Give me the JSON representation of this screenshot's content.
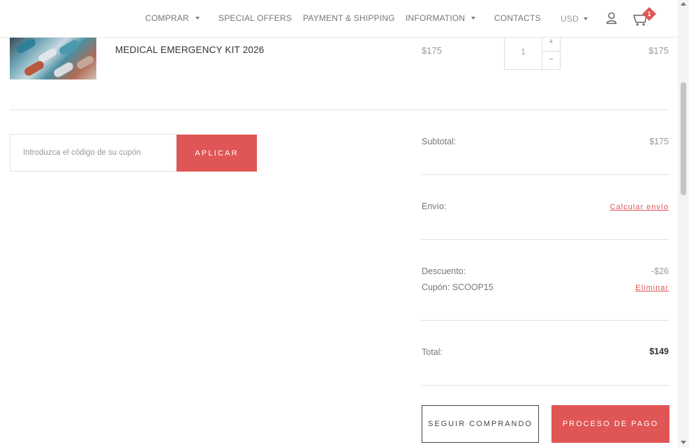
{
  "nav": {
    "items": [
      {
        "label": "COMPRAR",
        "has_dropdown": true
      },
      {
        "label": "SPECIAL OFFERS",
        "has_dropdown": false
      },
      {
        "label": "PAYMENT & SHIPPING",
        "has_dropdown": false
      },
      {
        "label": "INFORMATION",
        "has_dropdown": true
      },
      {
        "label": "CONTACTS",
        "has_dropdown": false
      }
    ],
    "currency": "USD",
    "cart_badge": "1",
    "icons": [
      "user-icon",
      "cart-icon"
    ]
  },
  "cart": {
    "items": [
      {
        "name": "MEDICAL EMERGENCY KIT 2026",
        "unit_price": "$175",
        "quantity": "1",
        "line_total": "$175"
      }
    ],
    "qty_plus": "+",
    "qty_minus": "−"
  },
  "coupon": {
    "placeholder": "Introduzca el código de su cupón",
    "apply_label": "APLICAR"
  },
  "totals": {
    "subtotal_label": "Subtotal:",
    "subtotal_value": "$175",
    "shipping_label": "Envío:",
    "shipping_link": "Calcular envío",
    "discount_label": "Descuento:",
    "discount_value": "-$26",
    "coupon_label": "Cupón: SCOOP15",
    "coupon_remove": "Eliminar",
    "total_label": "Total:",
    "total_value": "$149"
  },
  "actions": {
    "continue_label": "SEGUIR COMPRANDO",
    "checkout_label": "PROCESO DE PAGO"
  },
  "colors": {
    "accent": "#e05555",
    "text": "#333333",
    "muted": "#999999"
  }
}
